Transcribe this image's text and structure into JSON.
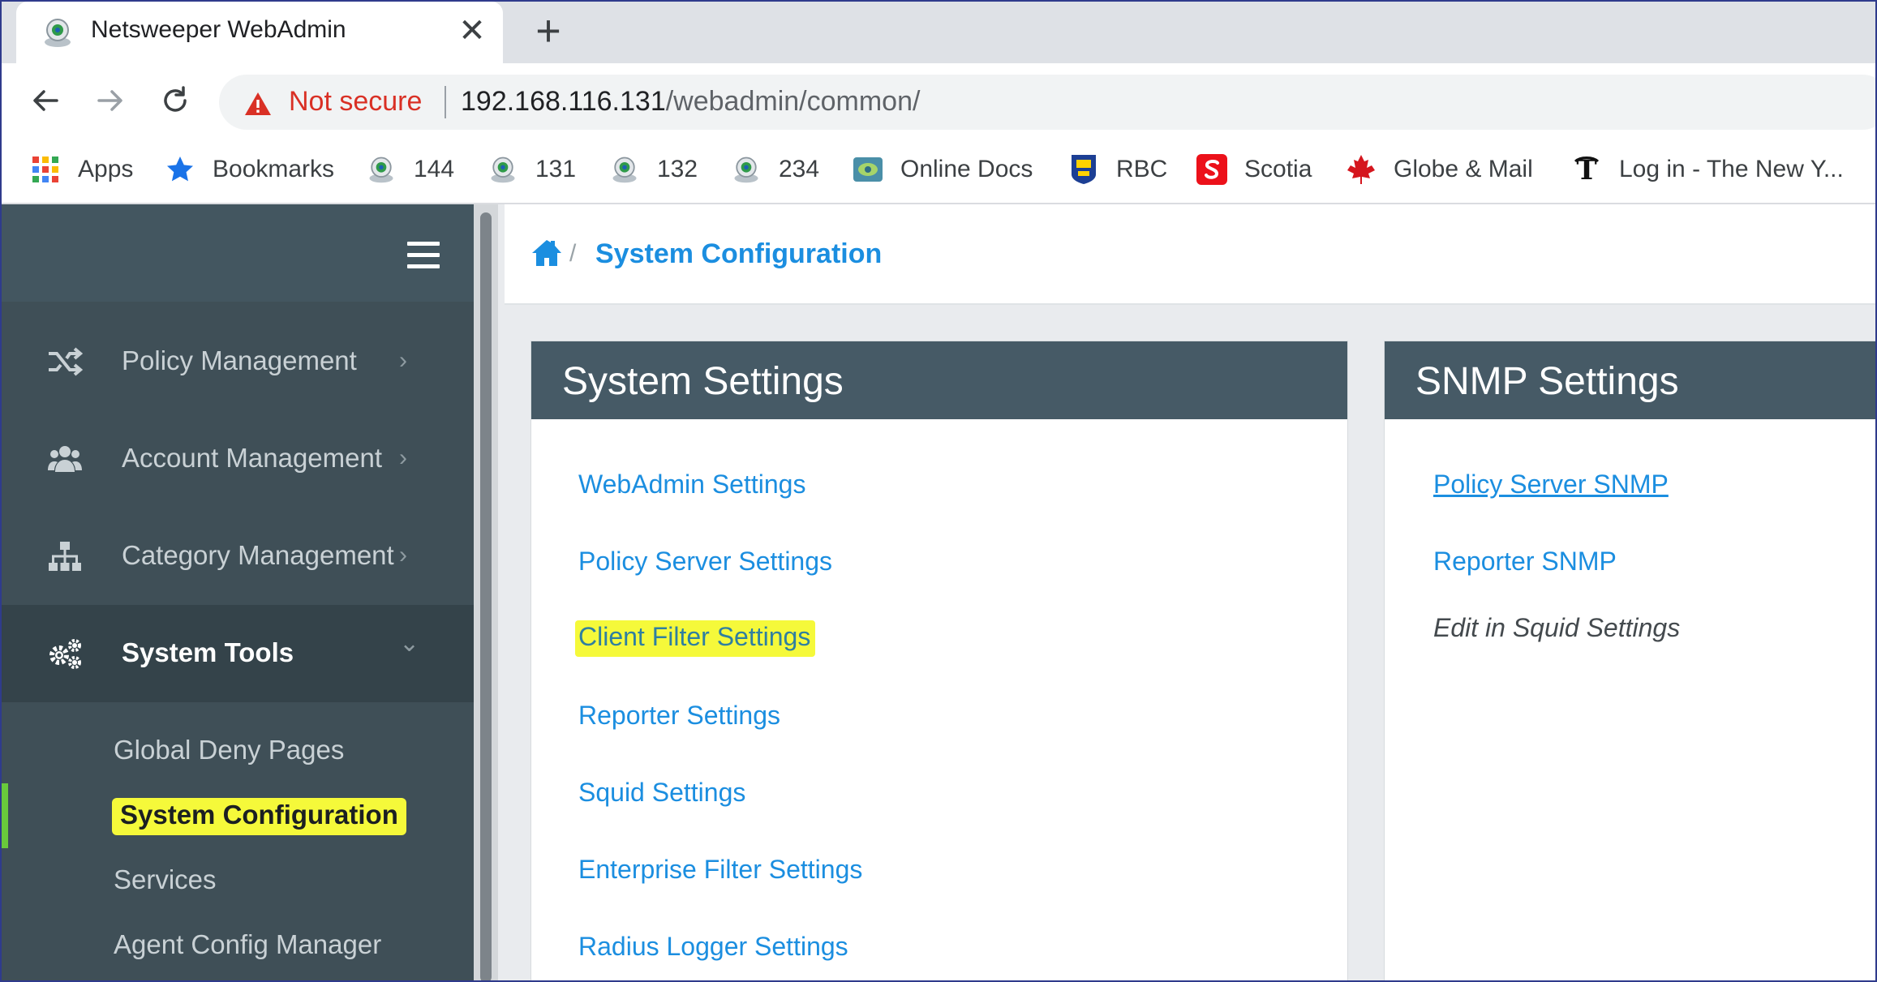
{
  "browser": {
    "tab_title": "Netsweeper WebAdmin",
    "close_glyph": "✕",
    "new_tab_glyph": "+",
    "security_label": "Not secure",
    "url_host": "192.168.116.131",
    "url_path": "/webadmin/common/",
    "bookmarks": [
      {
        "label": "Apps",
        "icon": "apps-grid-icon"
      },
      {
        "label": "Bookmarks",
        "icon": "star-icon"
      },
      {
        "label": "144",
        "icon": "netsweeper-icon"
      },
      {
        "label": "131",
        "icon": "netsweeper-icon"
      },
      {
        "label": "132",
        "icon": "netsweeper-icon"
      },
      {
        "label": "234",
        "icon": "netsweeper-icon"
      },
      {
        "label": "Online Docs",
        "icon": "docs-icon"
      },
      {
        "label": "RBC",
        "icon": "rbc-icon"
      },
      {
        "label": "Scotia",
        "icon": "scotia-icon"
      },
      {
        "label": "Globe & Mail",
        "icon": "maple-leaf-icon"
      },
      {
        "label": "Log in - The New Y...",
        "icon": "nyt-icon"
      }
    ]
  },
  "sidebar": {
    "menu": [
      {
        "label": "Policy Management",
        "icon": "shuffle-icon",
        "chevron": "›"
      },
      {
        "label": "Account Management",
        "icon": "users-icon",
        "chevron": "›"
      },
      {
        "label": "Category Management",
        "icon": "sitemap-icon",
        "chevron": "›"
      },
      {
        "label": "System Tools",
        "icon": "gears-icon",
        "chevron": "⌄"
      }
    ],
    "submenu": [
      {
        "label": "Global Deny Pages"
      },
      {
        "label": "System Configuration"
      },
      {
        "label": "Services"
      },
      {
        "label": "Agent Config Manager"
      }
    ]
  },
  "breadcrumb": {
    "separator": "/",
    "current": "System Configuration"
  },
  "system_settings": {
    "title": "System Settings",
    "links": [
      "WebAdmin Settings",
      "Policy Server Settings",
      "Client Filter Settings",
      "Reporter Settings",
      "Squid Settings",
      "Enterprise Filter Settings",
      "Radius Logger Settings"
    ]
  },
  "snmp_settings": {
    "title": "SNMP Settings",
    "links": [
      "Policy Server SNMP",
      "Reporter SNMP"
    ],
    "note": "Edit in Squid Settings"
  },
  "colors": {
    "sidebar_bg": "#3f4f57",
    "panel_header": "#465a66",
    "link": "#1b8ee0",
    "highlight": "#f5f93a",
    "active_indicator": "#69c93b"
  }
}
